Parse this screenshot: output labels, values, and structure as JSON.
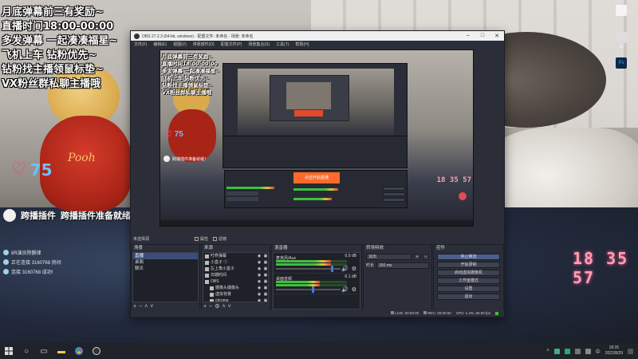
{
  "desktop": {
    "overlay_lines": [
      "月底弹幕前三有奖励~",
      "直播时间18:00-00:00",
      "多发弹幕 一起凑凑福星~",
      "飞机上车 钻粉优先~",
      "钻粉找主播领鼠标垫~",
      "VX粉丝群私聊主播哦"
    ],
    "heart_count": "75",
    "plugin_label": "跨播插件",
    "plugin_text": "跨播插件准备就绪！",
    "chat_items": [
      "8R演员除颤律",
      "正在连接 3160768 房间",
      "连接 3160768 成功!"
    ],
    "clock": "18 35 57",
    "pooh": "Pooh",
    "icons": [
      {
        "name": "file-icon",
        "label": ""
      },
      {
        "name": "app-icon",
        "label": "Q"
      },
      {
        "name": "ps-icon",
        "label": "Ps"
      }
    ]
  },
  "obs": {
    "title": "OBS 27.2.3 (64-bit, windows) - 配置文件: 未命名 - 场景: 未命名",
    "menu": [
      "文件(F)",
      "编辑(E)",
      "视图(V)",
      "停靠部件(D)",
      "配置文件(P)",
      "场景集合(S)",
      "工具(T)",
      "帮助(H)"
    ],
    "preview": {
      "lines": [
        "月底弹幕前三有奖励~",
        "直播时间18:00-00:00",
        "多发弹幕 一起凑凑福星~",
        "飞机上车 钻粉优先~",
        "钻粉找主播领鼠标垫~",
        "VX粉丝群私聊主播哦"
      ],
      "heart": "75",
      "plugin": "跨播插件准备就绪！",
      "clock": "18 35 57",
      "banner": "点击开始直播"
    },
    "transitions_bar": {
      "source_label": "未选择源",
      "props": "属性",
      "filters": "滤镜"
    },
    "scenes": {
      "header": "场景",
      "items": [
        "直播",
        "桌面",
        "聊天"
      ]
    },
    "sources": {
      "header": "来源",
      "items": [
        {
          "name": "叮咚弹幕",
          "child": false
        },
        {
          "name": "小盒子 ①",
          "child": false
        },
        {
          "name": "左上角小盒子",
          "child": false
        },
        {
          "name": "日期时间",
          "child": false
        },
        {
          "name": "OBS",
          "child": false
        },
        {
          "name": "摄像头摄像头",
          "child": true
        },
        {
          "name": "虚拟背景",
          "child": true
        },
        {
          "name": "chrome",
          "child": true
        }
      ]
    },
    "mixer": {
      "header": "混音器",
      "channels": [
        {
          "name": "麦克风/Aux",
          "db": "0.0 dB",
          "level": 0.78,
          "volume": 0.85
        },
        {
          "name": "桌面音频",
          "db": "-5.1 dB",
          "level": 0.62,
          "volume": 0.55
        }
      ]
    },
    "transitions": {
      "header": "转场特效",
      "type": "淡出",
      "duration_label": "时长",
      "duration": "300 ms"
    },
    "controls": {
      "header": "控件",
      "buttons": [
        "停止推流",
        "开始录制",
        "启动虚拟摄像机",
        "工作室模式",
        "设置",
        "退出"
      ]
    },
    "status": {
      "live": "LIVE: 00:00:00",
      "rec": "REC: 00:00:00",
      "cpu": "CPU: 1.4%, 60.00 fps"
    }
  },
  "taskbar": {
    "time": "18:35",
    "date": "2022/8/29"
  },
  "colors": {
    "obs_bg": "#2b2e38",
    "selection": "#3a4e7a",
    "clock_pink": "#ff9fb5",
    "heart_red": "#ff3d6e",
    "counter_blue": "#6fc0ff"
  }
}
